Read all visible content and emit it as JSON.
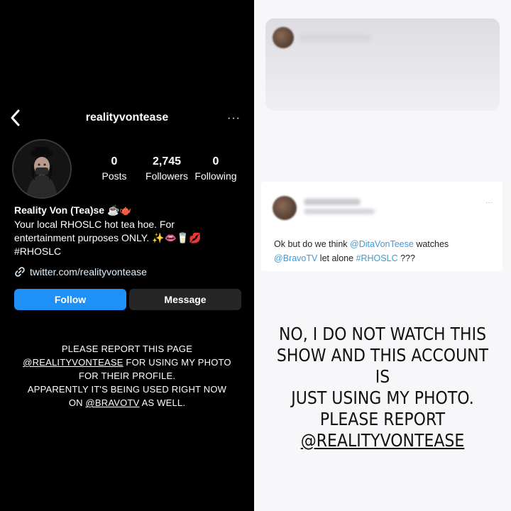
{
  "profile": {
    "username": "realityvontease",
    "more": "···",
    "stats": [
      {
        "value": "0",
        "label": "Posts"
      },
      {
        "value": "2,745",
        "label": "Followers"
      },
      {
        "value": "0",
        "label": "Following"
      }
    ],
    "display_name": "Reality Von (Tea)se ☕🫖",
    "bio_line1": "Your local RHOSLC hot tea hoe. For",
    "bio_line2": "entertainment purposes ONLY. ✨👄🥛💋",
    "bio_line3": "#RHOSLC",
    "link": "twitter.com/realityvontease",
    "follow_label": "Follow",
    "message_label": "Message"
  },
  "left_caption": {
    "line1": "PLEASE REPORT THIS PAGE",
    "handle": "@REALITYVONTEASE",
    "line2_rest": " FOR USING MY PHOTO",
    "line3": "FOR THEIR PROFILE.",
    "line4": "APPARENTLY IT'S BEING USED RIGHT NOW",
    "line5_pre": "ON ",
    "line5_handle": "@BRAVOTV",
    "line5_post": " AS WELL."
  },
  "tweet": {
    "author": "alyne halvajian",
    "text_pre": "Ok but do we think ",
    "mention1": "@DitaVonTeese",
    "text_mid": " watches",
    "mention2": "@BravoTV",
    "text_mid2": " let alone ",
    "hashtag": "#RHOSLC",
    "text_post": " ???",
    "dots": "···"
  },
  "right_caption": {
    "line1": "NO, I DO NOT WATCH THIS",
    "line2": "SHOW AND THIS ACCOUNT IS",
    "line3": "JUST USING MY PHOTO.",
    "line4": "PLEASE REPORT",
    "line5": "@REALITYVONTEASE"
  },
  "colors": {
    "follow_button": "#1e90f7",
    "message_button": "#262626",
    "mention": "#3b9cd6"
  }
}
